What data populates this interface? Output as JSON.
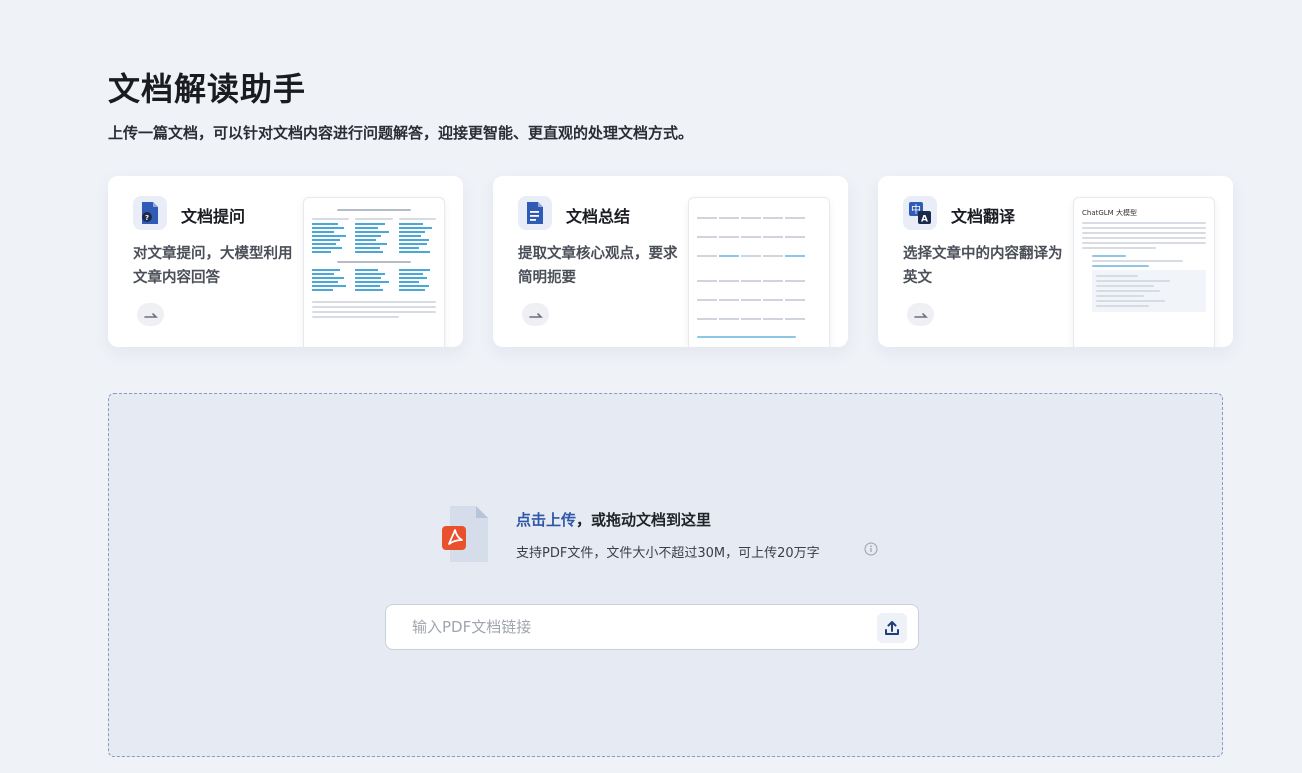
{
  "header": {
    "title": "文档解读助手",
    "subtitle": "上传一篇文档，可以针对文档内容进行问题解答，迎接更智能、更直观的处理文档方式。"
  },
  "cards": [
    {
      "title": "文档提问",
      "desc": "对文章提问，大模型利用文章内容回答",
      "icon": "question-doc-icon"
    },
    {
      "title": "文档总结",
      "desc": "提取文章核心观点，要求简明扼要",
      "icon": "summary-doc-icon"
    },
    {
      "title": "文档翻译",
      "desc": "选择文章中的内容翻译为英文",
      "icon": "translate-icon"
    }
  ],
  "translate_preview": {
    "heading": "ChatGLM 大模型"
  },
  "upload": {
    "link_text": "点击上传",
    "title_rest": "，或拖动文档到这里",
    "hint": "支持PDF文件，文件大小不超过30M，可上传20万字",
    "url_placeholder": "输入PDF文档链接",
    "url_value": ""
  },
  "colors": {
    "accent": "#2e57a6",
    "pdf_red": "#e8502e",
    "background": "#eff2f7"
  }
}
